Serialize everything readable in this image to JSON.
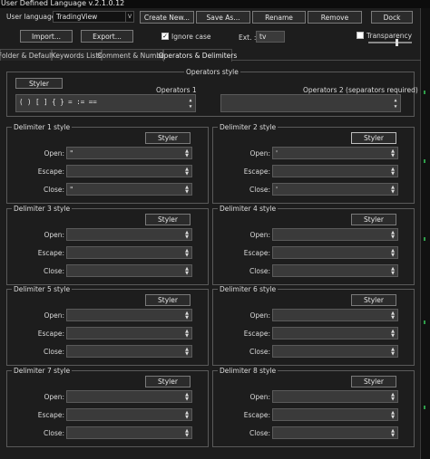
{
  "window": {
    "title": "User Defined Language v.2.1.0.12"
  },
  "toolbar": {
    "user_language_label": "User language :",
    "user_language_value": "TradingView",
    "create_new": "Create New...",
    "save_as": "Save As...",
    "rename": "Rename",
    "remove": "Remove",
    "dock": "Dock",
    "import": "Import...",
    "export": "Export...",
    "ignore_case": "Ignore case",
    "ignore_case_checked": true,
    "ext_label": "Ext. :",
    "ext_value": "tv",
    "transparency": "Transparency",
    "transparency_checked": false
  },
  "tabs": [
    {
      "label": "Folder & Default"
    },
    {
      "label": "Keywords Lists"
    },
    {
      "label": "Comment & Number"
    },
    {
      "label": "Operators & Delimiters"
    }
  ],
  "operators": {
    "group_title": "Operators style",
    "styler": "Styler",
    "operators1_label": "Operators 1",
    "operators1_value": "( ) [ ] { } = := ==",
    "operators2_label": "Operators 2 (separators required)",
    "operators2_value": ""
  },
  "delimiter_labels": {
    "open": "Open:",
    "escape": "Escape:",
    "close": "Close:",
    "styler": "Styler"
  },
  "delimiters": [
    {
      "title": "Delimiter 1 style",
      "open": "\"",
      "escape": "",
      "close": "\""
    },
    {
      "title": "Delimiter 2 style",
      "open": "'",
      "escape": "",
      "close": "'"
    },
    {
      "title": "Delimiter 3 style",
      "open": "",
      "escape": "",
      "close": ""
    },
    {
      "title": "Delimiter 4 style",
      "open": "",
      "escape": "",
      "close": ""
    },
    {
      "title": "Delimiter 5 style",
      "open": "",
      "escape": "",
      "close": ""
    },
    {
      "title": "Delimiter 6 style",
      "open": "",
      "escape": "",
      "close": ""
    },
    {
      "title": "Delimiter 7 style",
      "open": "",
      "escape": "",
      "close": ""
    },
    {
      "title": "Delimiter 8 style",
      "open": "",
      "escape": "",
      "close": ""
    }
  ]
}
